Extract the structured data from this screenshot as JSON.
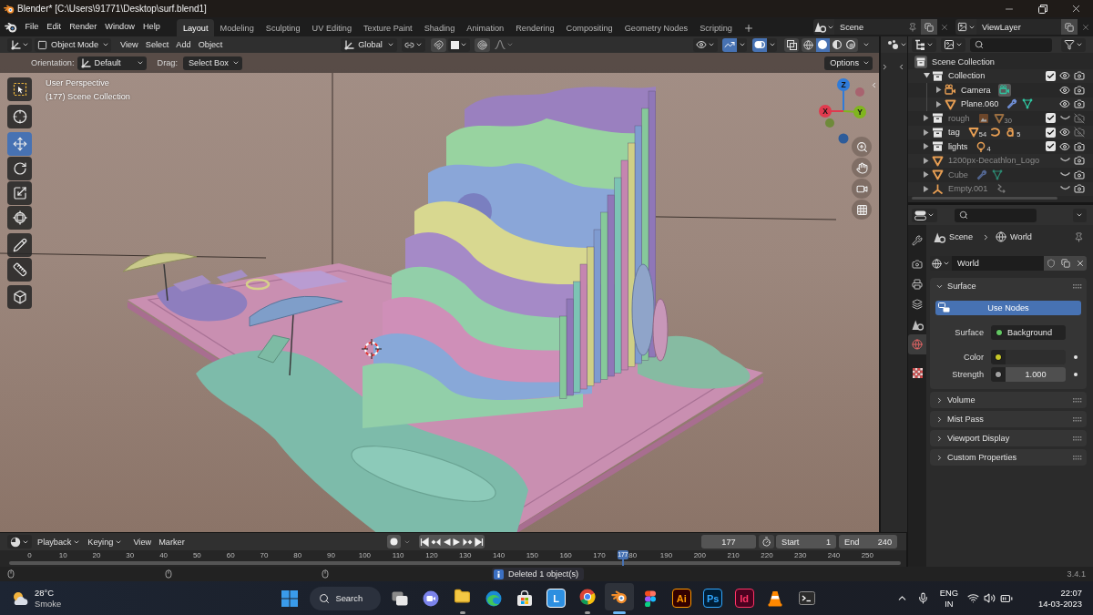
{
  "title_bar": {
    "title": "Blender* [C:\\Users\\91771\\Desktop\\surf.blend1]"
  },
  "menus": [
    "File",
    "Edit",
    "Render",
    "Window",
    "Help"
  ],
  "workspaces": [
    {
      "label": "Layout",
      "selected": true
    },
    {
      "label": "Modeling",
      "selected": false
    },
    {
      "label": "Sculpting",
      "selected": false
    },
    {
      "label": "UV Editing",
      "selected": false
    },
    {
      "label": "Texture Paint",
      "selected": false
    },
    {
      "label": "Shading",
      "selected": false
    },
    {
      "label": "Animation",
      "selected": false
    },
    {
      "label": "Rendering",
      "selected": false
    },
    {
      "label": "Compositing",
      "selected": false
    },
    {
      "label": "Geometry Nodes",
      "selected": false
    },
    {
      "label": "Scripting",
      "selected": false
    }
  ],
  "scene": {
    "name": "Scene"
  },
  "view_layer": {
    "name": "ViewLayer"
  },
  "viewport": {
    "mode": "Object Mode",
    "menus": [
      "View",
      "Select",
      "Add",
      "Object"
    ],
    "orientation": "Global",
    "gizmos": true,
    "overlays": true,
    "xray": false,
    "shading": [
      {
        "kind": "wireframe",
        "selected": false
      },
      {
        "kind": "solid",
        "selected": true
      },
      {
        "kind": "material",
        "selected": false
      },
      {
        "kind": "rendered",
        "selected": false
      }
    ],
    "tool_settings": {
      "orientation_label": "Orientation:",
      "orientation": "Default",
      "drag_label": "Drag:",
      "drag": "Select Box",
      "options": "Options"
    },
    "info": [
      "User Perspective",
      "(177) Scene Collection"
    ],
    "tools": [
      {
        "kind": "select",
        "selected": false
      },
      {
        "kind": "cursor",
        "selected": false
      },
      {
        "kind": "move",
        "selected": true
      },
      {
        "kind": "rotate",
        "selected": false
      },
      {
        "kind": "scale",
        "selected": false
      },
      {
        "kind": "transform",
        "selected": false
      },
      {
        "kind": "annotate",
        "selected": false
      },
      {
        "kind": "measure",
        "selected": false
      },
      {
        "kind": "add",
        "selected": false
      }
    ],
    "axes": [
      {
        "label": "Z",
        "color": "#2f7bd9"
      },
      {
        "label": "X",
        "color": "#e03a4e"
      },
      {
        "label": "Y",
        "color": "#80b51e"
      }
    ]
  },
  "outliner": {
    "items": [
      {
        "name": "Scene Collection",
        "kind": "scene_collection",
        "children": [
          {
            "name": "Collection",
            "kind": "collection",
            "expanded": true,
            "checked": true,
            "visible": true,
            "renderable": true,
            "children": [
              {
                "name": "Camera",
                "kind": "camera",
                "expanded": false,
                "visible": true,
                "renderable": true,
                "badges": [
                  {
                    "kind": "camera_data",
                    "active": true
                  }
                ]
              },
              {
                "name": "Plane.060",
                "kind": "mesh",
                "expanded": false,
                "visible": true,
                "renderable": true,
                "badges": [
                  {
                    "kind": "modifier",
                    "active": false
                  },
                  {
                    "kind": "mesh_data",
                    "active": false
                  }
                ]
              }
            ]
          },
          {
            "name": "rough",
            "kind": "collection",
            "expanded": false,
            "checked": true,
            "visible": false,
            "renderable": false,
            "badges": [
              {
                "kind": "image",
                "active": false
              },
              {
                "kind": "mesh",
                "count": "30",
                "active": false
              }
            ]
          },
          {
            "name": "tag",
            "kind": "collection",
            "expanded": false,
            "checked": true,
            "visible": true,
            "renderable": false,
            "badges": [
              {
                "kind": "mesh",
                "count": "54",
                "active": false
              },
              {
                "kind": "curve",
                "active": false
              },
              {
                "kind": "text",
                "count": "5",
                "active": false
              }
            ]
          },
          {
            "name": "lights",
            "kind": "collection",
            "expanded": false,
            "checked": true,
            "visible": true,
            "renderable": true,
            "badges": [
              {
                "kind": "light",
                "count": "4",
                "active": false
              }
            ]
          },
          {
            "name": "1200px-Decathlon_Logo",
            "kind": "mesh",
            "expanded": false,
            "visible": false,
            "renderable": true
          },
          {
            "name": "Cube",
            "kind": "mesh",
            "expanded": false,
            "visible": false,
            "renderable": true,
            "badges": [
              {
                "kind": "modifier",
                "active": false
              },
              {
                "kind": "mesh_data",
                "active": false
              }
            ]
          },
          {
            "name": "Empty.001",
            "kind": "empty",
            "expanded": false,
            "visible": false,
            "renderable": true,
            "badges": [
              {
                "kind": "constraint",
                "active": false
              }
            ]
          }
        ]
      }
    ]
  },
  "properties": {
    "tabs": [
      {
        "kind": "tool",
        "selected": false
      },
      {
        "kind": "render",
        "selected": false
      },
      {
        "kind": "output",
        "selected": false
      },
      {
        "kind": "view_layer",
        "selected": false
      },
      {
        "kind": "scene",
        "selected": false
      },
      {
        "kind": "world",
        "selected": true
      },
      {
        "kind": "texture",
        "selected": false
      }
    ],
    "breadcrumb": [
      {
        "kind": "scene",
        "label": "Scene"
      },
      {
        "kind": "world",
        "label": "World"
      }
    ],
    "world": "World",
    "panels": [
      {
        "title": "Surface",
        "expanded": true,
        "use_nodes": "Use Nodes",
        "rows": [
          {
            "kind": "shader",
            "label": "Surface",
            "value": "Background",
            "color": "#63c763"
          },
          {
            "kind": "color",
            "label": "Color",
            "color": "#c7c729",
            "swatch": {
              "color": "#2e2e2e"
            }
          },
          {
            "kind": "number",
            "label": "Strength",
            "value": "1.000",
            "color": "#a1a1a1"
          }
        ]
      },
      {
        "title": "Volume",
        "expanded": false
      },
      {
        "title": "Mist Pass",
        "expanded": false
      },
      {
        "title": "Viewport Display",
        "expanded": false
      },
      {
        "title": "Custom Properties",
        "expanded": false
      }
    ]
  },
  "timeline": {
    "menus": [
      {
        "label": "Playback",
        "dropdown": true
      },
      {
        "label": "Keying",
        "dropdown": true
      },
      {
        "label": "View",
        "dropdown": false
      },
      {
        "label": "Marker",
        "dropdown": false
      }
    ],
    "frame": "177",
    "start_label": "Start",
    "start": "1",
    "end_label": "End",
    "end": "240",
    "ticks": [
      "0",
      "10",
      "20",
      "30",
      "40",
      "50",
      "60",
      "70",
      "80",
      "90",
      "100",
      "110",
      "120",
      "130",
      "140",
      "150",
      "160",
      "170",
      "80",
      "190",
      "200",
      "210",
      "220",
      "230",
      "240",
      "250"
    ],
    "playhead": {
      "label": "177"
    }
  },
  "status_bar": {
    "message": "Deleted 1 object(s)",
    "version": "3.4.1"
  },
  "taskbar": {
    "weather": {
      "temperature": "28°C",
      "condition": "Smoke"
    },
    "search": "Search",
    "apps": [
      {
        "kind": "taskview",
        "running": false,
        "selected": false
      },
      {
        "kind": "chat",
        "running": false,
        "selected": false
      },
      {
        "kind": "explorer",
        "running": true,
        "selected": false
      },
      {
        "kind": "edge",
        "running": false,
        "selected": false
      },
      {
        "kind": "store",
        "running": false,
        "selected": false
      },
      {
        "kind": "letter",
        "label": "L",
        "color": "#ffffff",
        "tile": {
          "color": "#2d8fe0"
        },
        "running": false,
        "selected": false
      },
      {
        "kind": "chrome",
        "running": true,
        "selected": false
      },
      {
        "kind": "blender",
        "running": true,
        "selected": true
      },
      {
        "kind": "figma",
        "running": false,
        "selected": false
      },
      {
        "kind": "letter",
        "label": "Ai",
        "color": "#ff9a00",
        "tile": {
          "color": "#330000"
        },
        "running": false,
        "selected": false
      },
      {
        "kind": "letter",
        "label": "Ps",
        "color": "#31a8ff",
        "tile": {
          "color": "#001e36"
        },
        "running": false,
        "selected": false
      },
      {
        "kind": "letter",
        "label": "Id",
        "color": "#ff3366",
        "tile": {
          "color": "#49021f"
        },
        "running": false,
        "selected": false
      },
      {
        "kind": "vlc",
        "running": false,
        "selected": false
      },
      {
        "kind": "terminal",
        "running": false,
        "selected": false
      }
    ],
    "language": [
      "ENG",
      "IN"
    ],
    "time": "22:07",
    "date": "14-03-2023"
  }
}
